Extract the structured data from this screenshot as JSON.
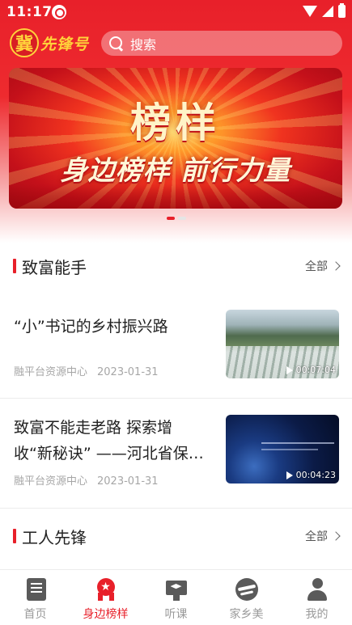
{
  "status_bar": {
    "time": "11:17"
  },
  "header": {
    "logo_seal": "冀",
    "logo_text": "先锋号",
    "search_placeholder": "搜索"
  },
  "banner": {
    "title": "榜样",
    "subtitle": "身边榜样 前行力量",
    "page_count": 2,
    "active_page": 1
  },
  "sections": [
    {
      "title": "致富能手",
      "more_label": "全部",
      "articles": [
        {
          "title": "“小”书记的乡村振兴路",
          "source": "融平台资源中心",
          "date": "2023-01-31",
          "duration": "00:07:04"
        },
        {
          "title": "致富不能走老路 探索增收“新秘诀” ——河北省保…",
          "source": "融平台资源中心",
          "date": "2023-01-31",
          "duration": "00:04:23"
        }
      ]
    },
    {
      "title": "工人先锋",
      "more_label": "全部"
    }
  ],
  "bottom_nav": {
    "items": [
      {
        "label": "首页",
        "icon": "newspaper-icon",
        "active": false
      },
      {
        "label": "身边榜样",
        "icon": "medal-icon",
        "active": true
      },
      {
        "label": "听课",
        "icon": "classroom-icon",
        "active": false
      },
      {
        "label": "家乡美",
        "icon": "hometown-icon",
        "active": false
      },
      {
        "label": "我的",
        "icon": "user-icon",
        "active": false
      }
    ]
  },
  "colors": {
    "accent": "#e8202a",
    "logo_gold": "#ffd23a"
  }
}
